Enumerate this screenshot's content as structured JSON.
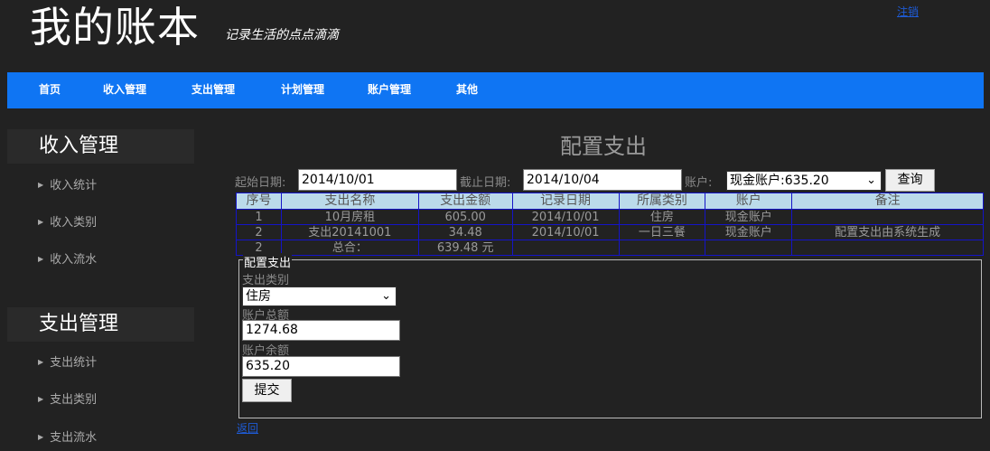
{
  "header": {
    "title": "我的账本",
    "subtitle": "记录生活的点点滴滴",
    "logout": "注销"
  },
  "nav": {
    "items": [
      "首页",
      "收入管理",
      "支出管理",
      "计划管理",
      "账户管理",
      "其他"
    ]
  },
  "sidebar": {
    "income": {
      "heading": "收入管理",
      "items": [
        "收入统计",
        "收入类别",
        "收入流水"
      ]
    },
    "expense": {
      "heading": "支出管理",
      "items": [
        "支出统计",
        "支出类别",
        "支出流水"
      ]
    }
  },
  "main": {
    "title": "配置支出",
    "filter": {
      "start_label": "起始日期:",
      "start_value": "2014/10/01",
      "end_label": "截止日期:",
      "end_value": "2014/10/04",
      "account_label": "账户:",
      "account_value": "现金账户:635.20",
      "query_button": "查询"
    },
    "table": {
      "headers": [
        "序号",
        "支出名称",
        "支出金额",
        "记录日期",
        "所属类别",
        "账户",
        "备注"
      ],
      "rows": [
        [
          "1",
          "10月房租",
          "605.00",
          "2014/10/01",
          "住房",
          "现金账户",
          ""
        ],
        [
          "2",
          "支出20141001",
          "34.48",
          "2014/10/01",
          "一日三餐",
          "现金账户",
          "配置支出由系统生成"
        ]
      ],
      "summary": [
        "2",
        "总合：",
        "639.48 元",
        "",
        "",
        "",
        ""
      ]
    },
    "config": {
      "legend": "配置支出",
      "category_label": "支出类别",
      "category_value": "住房",
      "total_label": "账户总额",
      "total_value": "1274.68",
      "balance_label": "账户余额",
      "balance_value": "635.20",
      "submit_button": "提交"
    },
    "back_link": "返回"
  },
  "colors": {
    "nav_bg": "#0f75f3",
    "page_bg": "#222222",
    "table_header_bg": "#bbdaea",
    "table_border": "#1414c8"
  }
}
